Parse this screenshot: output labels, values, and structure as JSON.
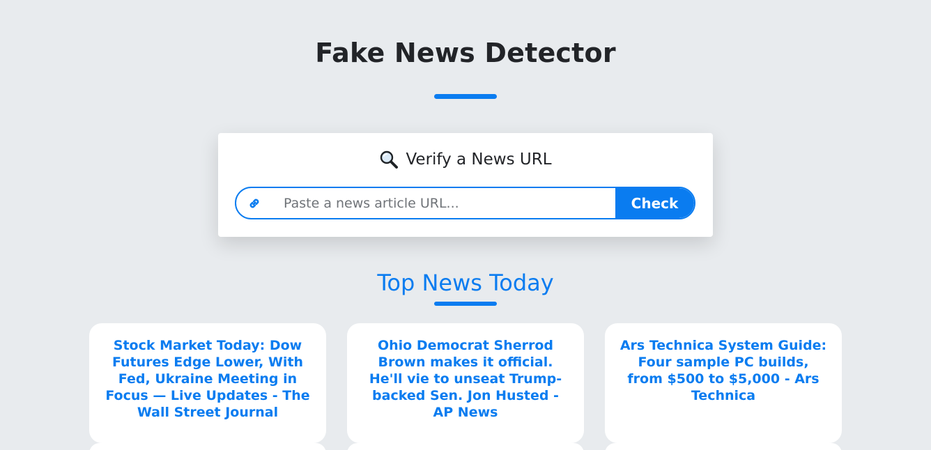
{
  "header": {
    "title": "Fake News Detector"
  },
  "verify": {
    "title": "Verify a News URL",
    "input_placeholder": "Paste a news article URL...",
    "input_value": "",
    "check_label": "Check"
  },
  "top_news": {
    "title": "Top News Today",
    "articles": [
      {
        "headline": "Stock Market Today: Dow Futures Edge Lower, With Fed, Ukraine Meeting in Focus — Live Updates - The Wall Street Journal"
      },
      {
        "headline": "Ohio Democrat Sherrod Brown makes it official. He'll vie to unseat Trump-backed Sen. Jon Husted - AP News"
      },
      {
        "headline": "Ars Technica System Guide: Four sample PC builds, from $500 to $5,000 - Ars Technica"
      }
    ]
  },
  "icons": {
    "verify": "magnifier-icon",
    "url": "link-icon"
  },
  "colors": {
    "accent": "#0a7cf0",
    "background": "#e8ebee",
    "card": "#ffffff",
    "text": "#222428"
  }
}
